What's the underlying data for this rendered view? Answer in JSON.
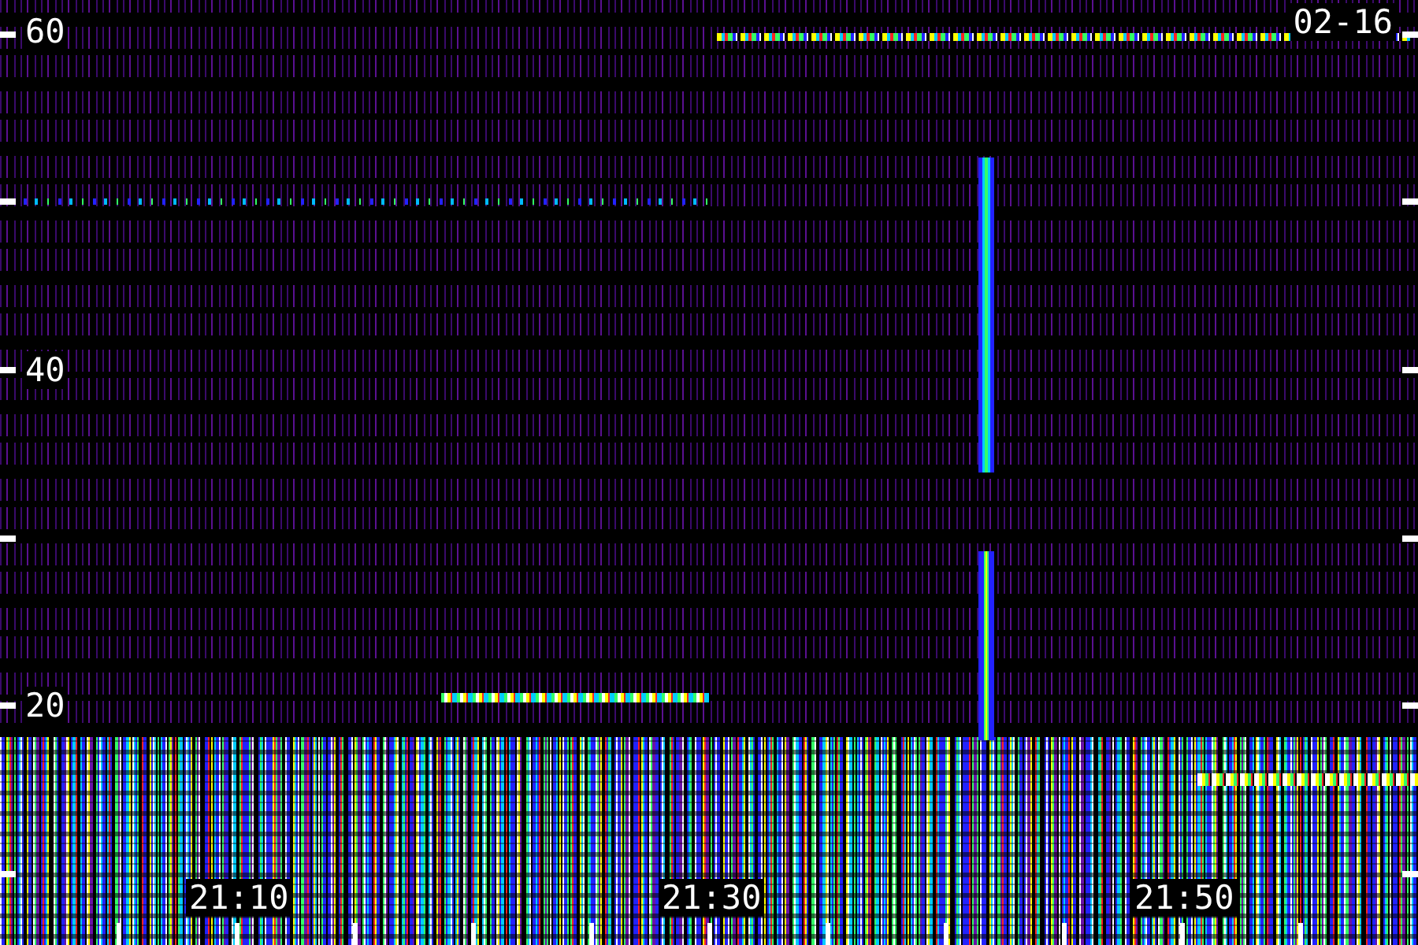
{
  "frequency_labels": [
    "60",
    "40",
    "20"
  ],
  "date_label": "02-16",
  "time_labels": [
    "21:10",
    "21:30",
    "21:50"
  ]
}
